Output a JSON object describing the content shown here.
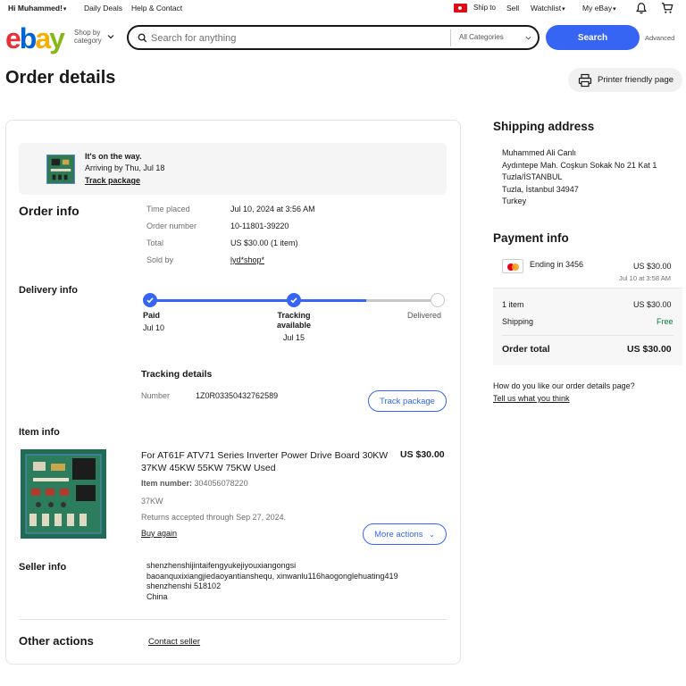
{
  "topbar": {
    "greeting": "Hi Muhammed!",
    "daily_deals": "Daily Deals",
    "help": "Help & Contact",
    "ship_to": "Ship to",
    "sell": "Sell",
    "watchlist": "Watchlist",
    "my_ebay": "My eBay"
  },
  "header": {
    "logo": [
      "e",
      "b",
      "a",
      "y"
    ],
    "shop_by": "Shop by category",
    "search_placeholder": "Search for anything",
    "categories": "All Categories",
    "search_button": "Search",
    "advanced": "Advanced"
  },
  "page": {
    "title": "Order details",
    "printer": "Printer friendly page"
  },
  "status": {
    "line1": "It's on the way.",
    "line2": "Arriving by Thu, Jul 18",
    "link": "Track package"
  },
  "order_info": {
    "heading": "Order info",
    "rows": [
      {
        "label": "Time placed",
        "value": "Jul 10, 2024 at 3:56 AM"
      },
      {
        "label": "Order number",
        "value": "10-11801-39220"
      },
      {
        "label": "Total",
        "value": "US $30.00 (1 item)"
      },
      {
        "label": "Sold by",
        "value": "lyd*shop*"
      }
    ]
  },
  "delivery": {
    "heading": "Delivery info",
    "steps": [
      {
        "label": "Paid",
        "date": "Jul 10"
      },
      {
        "label": "Tracking available",
        "date": "Jul 15"
      },
      {
        "label": "Delivered",
        "date": ""
      }
    ],
    "progress_fraction": 0.75,
    "tracking_heading": "Tracking details",
    "number_label": "Number",
    "number_value": "1Z0R03350432762589",
    "track_button": "Track package"
  },
  "item": {
    "heading": "Item info",
    "title": "For AT61F ATV71 Series Inverter Power Drive Board 30KW 37KW 45KW 55KW 75KW Used",
    "price": "US $30.00",
    "number_label": "Item number:",
    "number_value": "304056078220",
    "variant": "37KW",
    "returns": "Returns accepted through Sep 27, 2024.",
    "buy_again": "Buy again",
    "more_actions": "More actions"
  },
  "seller": {
    "heading": "Seller info",
    "lines": [
      "shenzhenshijintaifengyukejiyouxiangongsi",
      "baoanquxixiangjiedaoyantianshequ, xinwanlu116haogonglehuating419",
      "shenzhenshi 518102",
      "China"
    ]
  },
  "other": {
    "heading": "Other actions",
    "contact": "Contact seller"
  },
  "shipping": {
    "heading": "Shipping address",
    "lines": [
      "Muhammed Ali Canlı",
      "Aydıntepe Mah. Coşkun Sokak No 21 Kat 1",
      "Tuzla/İSTANBUL",
      "Tuzla, İstanbul 34947",
      "Turkey"
    ]
  },
  "payment": {
    "heading": "Payment info",
    "card": "Ending in 3456",
    "card_amount": "US $30.00",
    "card_date": "Jul 10 at 3:58 AM",
    "items_label": "1 item",
    "items_amount": "US $30.00",
    "shipping_label": "Shipping",
    "shipping_amount": "Free",
    "total_label": "Order total",
    "total_amount": "US $30.00"
  },
  "feedback": {
    "question": "How do you like our order details page?",
    "link": "Tell us what you think"
  },
  "colors": {
    "accent": "#3665f3",
    "free": "#05823f"
  }
}
